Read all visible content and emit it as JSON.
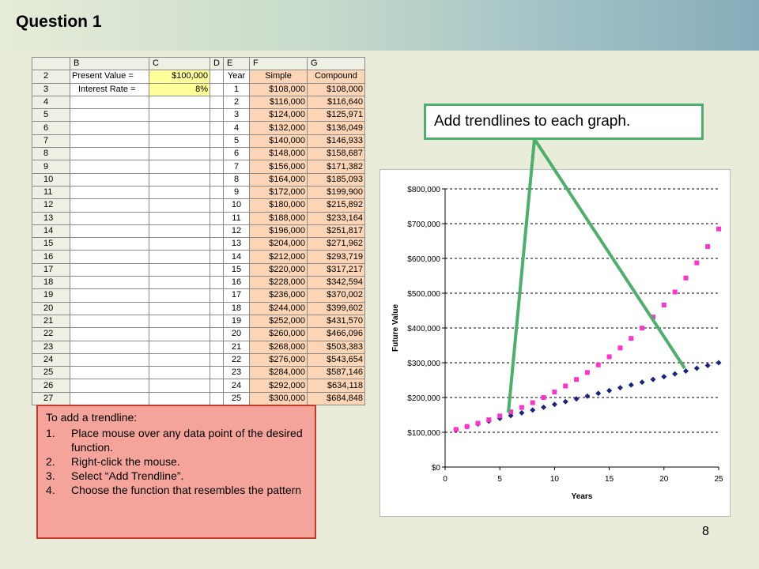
{
  "header": {
    "title": "Question 1"
  },
  "sheet": {
    "col_headers": [
      "B",
      "C",
      "D",
      "E",
      "F",
      "G"
    ],
    "row2": {
      "num": "2",
      "label": "Present Value =",
      "value": "$100,000",
      "year_h": "Year",
      "simple_h": "Simple",
      "compound_h": "Compound"
    },
    "row3": {
      "num": "3",
      "label": "Interest Rate =",
      "value": "8%"
    },
    "rows": [
      {
        "num": "3",
        "year": "1",
        "simple": "$108,000",
        "compound": "$108,000"
      },
      {
        "num": "4",
        "year": "2",
        "simple": "$116,000",
        "compound": "$116,640"
      },
      {
        "num": "5",
        "year": "3",
        "simple": "$124,000",
        "compound": "$125,971"
      },
      {
        "num": "6",
        "year": "4",
        "simple": "$132,000",
        "compound": "$136,049"
      },
      {
        "num": "7",
        "year": "5",
        "simple": "$140,000",
        "compound": "$146,933"
      },
      {
        "num": "8",
        "year": "6",
        "simple": "$148,000",
        "compound": "$158,687"
      },
      {
        "num": "9",
        "year": "7",
        "simple": "$156,000",
        "compound": "$171,382"
      },
      {
        "num": "10",
        "year": "8",
        "simple": "$164,000",
        "compound": "$185,093"
      },
      {
        "num": "11",
        "year": "9",
        "simple": "$172,000",
        "compound": "$199,900"
      },
      {
        "num": "12",
        "year": "10",
        "simple": "$180,000",
        "compound": "$215,892"
      },
      {
        "num": "13",
        "year": "11",
        "simple": "$188,000",
        "compound": "$233,164"
      },
      {
        "num": "14",
        "year": "12",
        "simple": "$196,000",
        "compound": "$251,817"
      },
      {
        "num": "15",
        "year": "13",
        "simple": "$204,000",
        "compound": "$271,962"
      },
      {
        "num": "16",
        "year": "14",
        "simple": "$212,000",
        "compound": "$293,719"
      },
      {
        "num": "17",
        "year": "15",
        "simple": "$220,000",
        "compound": "$317,217"
      },
      {
        "num": "18",
        "year": "16",
        "simple": "$228,000",
        "compound": "$342,594"
      },
      {
        "num": "19",
        "year": "17",
        "simple": "$236,000",
        "compound": "$370,002"
      },
      {
        "num": "20",
        "year": "18",
        "simple": "$244,000",
        "compound": "$399,602"
      },
      {
        "num": "21",
        "year": "19",
        "simple": "$252,000",
        "compound": "$431,570"
      },
      {
        "num": "22",
        "year": "20",
        "simple": "$260,000",
        "compound": "$466,096"
      },
      {
        "num": "23",
        "year": "21",
        "simple": "$268,000",
        "compound": "$503,383"
      },
      {
        "num": "24",
        "year": "22",
        "simple": "$276,000",
        "compound": "$543,654"
      },
      {
        "num": "25",
        "year": "23",
        "simple": "$284,000",
        "compound": "$587,146"
      },
      {
        "num": "26",
        "year": "24",
        "simple": "$292,000",
        "compound": "$634,118"
      },
      {
        "num": "27",
        "year": "25",
        "simple": "$300,000",
        "compound": "$684,848"
      }
    ]
  },
  "instructions": {
    "heading": "To add a trendline:",
    "steps": [
      {
        "n": "1.",
        "text": "Place mouse over any data point of the desired function."
      },
      {
        "n": "2.",
        "text": "Right-click the mouse."
      },
      {
        "n": "3.",
        "text": "Select “Add Trendline”."
      },
      {
        "n": "4.",
        "text": "Choose the function that resembles the pattern"
      }
    ]
  },
  "callout": {
    "text": "Add trendlines to each graph."
  },
  "page_number": "8",
  "colors": {
    "simple": "#1a237e",
    "compound": "#ff33cc",
    "callout_border": "#4caf6e"
  },
  "chart_data": {
    "type": "scatter",
    "xlabel": "Years",
    "ylabel": "Future Value",
    "xlim": [
      0,
      25
    ],
    "ylim": [
      0,
      800000
    ],
    "x_ticks": [
      "0",
      "5",
      "10",
      "15",
      "20",
      "25"
    ],
    "y_ticks": [
      "$0",
      "$100,000",
      "$200,000",
      "$300,000",
      "$400,000",
      "$500,000",
      "$600,000",
      "$700,000",
      "$800,000"
    ],
    "grid": "horizontal dashed",
    "series": [
      {
        "key": "simple",
        "marker": "diamond",
        "x": [
          1,
          2,
          3,
          4,
          5,
          6,
          7,
          8,
          9,
          10,
          11,
          12,
          13,
          14,
          15,
          16,
          17,
          18,
          19,
          20,
          21,
          22,
          23,
          24,
          25
        ],
        "values": [
          108000,
          116000,
          124000,
          132000,
          140000,
          148000,
          156000,
          164000,
          172000,
          180000,
          188000,
          196000,
          204000,
          212000,
          220000,
          228000,
          236000,
          244000,
          252000,
          260000,
          268000,
          276000,
          284000,
          292000,
          300000
        ]
      },
      {
        "key": "compound",
        "marker": "square",
        "x": [
          1,
          2,
          3,
          4,
          5,
          6,
          7,
          8,
          9,
          10,
          11,
          12,
          13,
          14,
          15,
          16,
          17,
          18,
          19,
          20,
          21,
          22,
          23,
          24,
          25
        ],
        "values": [
          108000,
          116640,
          125971,
          136049,
          146933,
          158687,
          171382,
          185093,
          199900,
          215892,
          233164,
          251817,
          271962,
          293719,
          317217,
          342594,
          370002,
          399602,
          431570,
          466096,
          503383,
          543654,
          587146,
          634118,
          684848
        ]
      }
    ]
  }
}
